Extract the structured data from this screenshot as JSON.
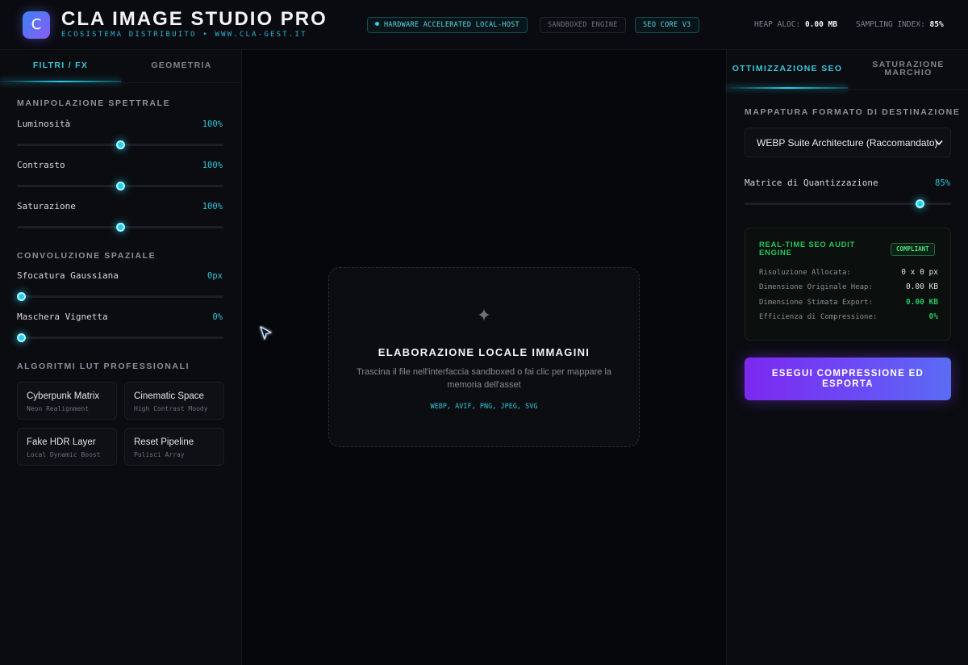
{
  "header": {
    "logo_letter": "C",
    "title": "CLA IMAGE STUDIO PRO",
    "subtitle": "ECOSISTEMA DISTRIBUITO • WWW.CLA-GEST.IT",
    "badges": {
      "hardware": "HARDWARE ACCELERATED LOCAL-HOST",
      "sandboxed": "SANDBOXED ENGINE",
      "seo": "SEO CORE V3"
    },
    "heap_label": "HEAP ALOC:",
    "heap_value": "0.00 MB",
    "sampling_label": "SAMPLING INDEX:",
    "sampling_value": "85%"
  },
  "left": {
    "tabs": [
      "FILTRI / FX",
      "GEOMETRIA"
    ],
    "active_tab": 0,
    "spectral": {
      "title": "MANIPOLAZIONE SPETTRALE",
      "controls": [
        {
          "label": "Luminosità",
          "value": "100%",
          "level": 0.5
        },
        {
          "label": "Contrasto",
          "value": "100%",
          "level": 0.5
        },
        {
          "label": "Saturazione",
          "value": "100%",
          "level": 0.5
        }
      ]
    },
    "convolution": {
      "title": "CONVOLUZIONE SPAZIALE",
      "controls": [
        {
          "label": "Sfocatura Gaussiana",
          "value": "0px",
          "level": 0
        },
        {
          "label": "Maschera Vignetta",
          "value": "0%",
          "level": 0
        }
      ]
    },
    "lut": {
      "title": "ALGORITMI LUT PROFESSIONALI",
      "cards": [
        {
          "name": "Cyberpunk Matrix",
          "sub": "Neon Realignment"
        },
        {
          "name": "Cinematic Space",
          "sub": "High Contrast Moody"
        },
        {
          "name": "Fake HDR Layer",
          "sub": "Local Dynamic Boost"
        },
        {
          "name": "Reset Pipeline",
          "sub": "Pulisci Array"
        }
      ]
    }
  },
  "canvas": {
    "drop_title": "ELABORAZIONE LOCALE IMMAGINI",
    "drop_desc": "Trascina il file nell'interfaccia sandboxed o fai clic per mappare la memoria dell'asset",
    "drop_formats": "WEBP, AVIF, PNG, JPEG, SVG"
  },
  "right": {
    "tabs": [
      "OTTIMIZZAZIONE SEO",
      "SATURAZIONE MARCHIO"
    ],
    "active_tab": 0,
    "format_title": "MAPPATURA FORMATO DI DESTINAZIONE",
    "format_selected": "WEBP Suite Architecture (Raccomandato)",
    "quant_label": "Matrice di Quantizzazione",
    "quant_value": "85%",
    "quant_level": 0.85,
    "audit": {
      "title": "REAL-TIME SEO AUDIT ENGINE",
      "badge": "COMPLIANT",
      "rows": [
        {
          "label": "Risoluzione Allocata:",
          "value": "0 x 0 px"
        },
        {
          "label": "Dimensione Originale Heap:",
          "value": "0.00 KB"
        },
        {
          "label": "Dimensione Stimata Export:",
          "value": "0.00 KB"
        },
        {
          "label": "Efficienza di Compressione:",
          "value": "0%"
        }
      ]
    },
    "export_label": "ESEGUI COMPRESSIONE ED ESPORTA"
  },
  "colors": {
    "accent_cyan": "#22d3ee",
    "accent_green": "#22c55e",
    "accent_violet": "#7c3aed",
    "background": "#07080b"
  }
}
